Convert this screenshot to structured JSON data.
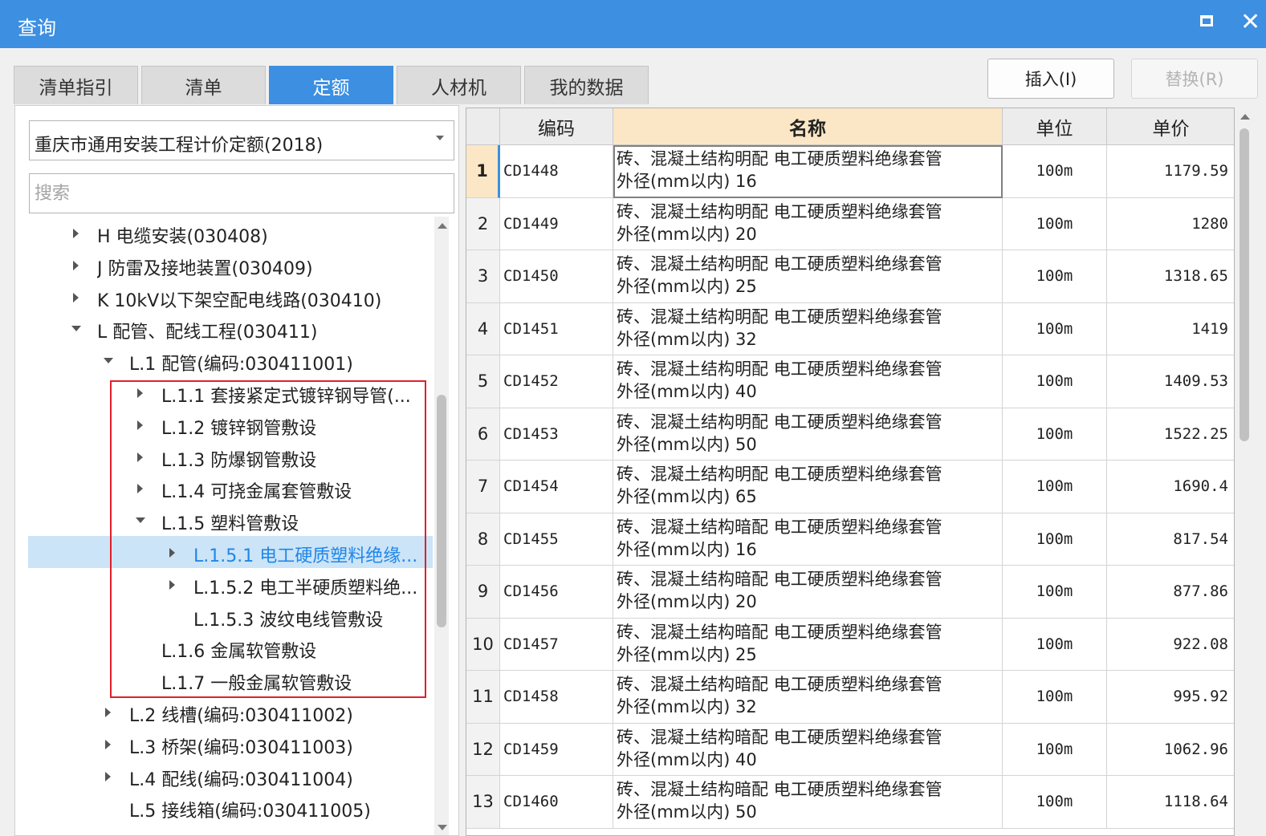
{
  "window": {
    "title": "查询"
  },
  "tabs": [
    {
      "label": "清单指引"
    },
    {
      "label": "清单"
    },
    {
      "label": "定额"
    },
    {
      "label": "人材机"
    },
    {
      "label": "我的数据"
    }
  ],
  "buttons": {
    "insert": "插入(I)",
    "replace": "替换(R)"
  },
  "left": {
    "library": "重庆市通用安装工程计价定额(2018)",
    "search_placeholder": "搜索"
  },
  "tree": [
    {
      "label": "H 电缆安装(030408)",
      "expand": "collapsed"
    },
    {
      "label": "J 防雷及接地装置(030409)",
      "expand": "collapsed"
    },
    {
      "label": "K 10kV以下架空配电线路(030410)",
      "expand": "collapsed"
    },
    {
      "label": "L 配管、配线工程(030411)",
      "expand": "expanded"
    },
    {
      "label": "L.1 配管(编码:030411001)",
      "expand": "expanded"
    },
    {
      "label": "L.1.1 套接紧定式镀锌钢导管(...",
      "expand": "collapsed"
    },
    {
      "label": "L.1.2 镀锌钢管敷设",
      "expand": "collapsed"
    },
    {
      "label": "L.1.3 防爆钢管敷设",
      "expand": "collapsed"
    },
    {
      "label": "L.1.4 可挠金属套管敷设",
      "expand": "collapsed"
    },
    {
      "label": "L.1.5 塑料管敷设",
      "expand": "expanded"
    },
    {
      "label": "L.1.5.1 电工硬质塑料绝缘...",
      "expand": "collapsed",
      "selected": true
    },
    {
      "label": "L.1.5.2 电工半硬质塑料绝...",
      "expand": "collapsed"
    },
    {
      "label": "L.1.5.3 波纹电线管敷设",
      "expand": "none"
    },
    {
      "label": "L.1.6 金属软管敷设",
      "expand": "none"
    },
    {
      "label": "L.1.7 一般金属软管敷设",
      "expand": "none"
    },
    {
      "label": "L.2 线槽(编码:030411002)",
      "expand": "collapsed"
    },
    {
      "label": "L.3 桥架(编码:030411003)",
      "expand": "collapsed"
    },
    {
      "label": "L.4 配线(编码:030411004)",
      "expand": "collapsed"
    },
    {
      "label": "L.5 接线箱(编码:030411005)",
      "expand": "none"
    }
  ],
  "table": {
    "columns": [
      "",
      "编码",
      "名称",
      "单位",
      "单价"
    ],
    "rows": [
      {
        "no": "1",
        "code": "CD1448",
        "name": "砖、混凝土结构明配 电工硬质塑料绝缘套管\n外径(mm以内) 16",
        "unit": "100m",
        "price": "1179.59"
      },
      {
        "no": "2",
        "code": "CD1449",
        "name": "砖、混凝土结构明配 电工硬质塑料绝缘套管\n外径(mm以内) 20",
        "unit": "100m",
        "price": "1280"
      },
      {
        "no": "3",
        "code": "CD1450",
        "name": "砖、混凝土结构明配 电工硬质塑料绝缘套管\n外径(mm以内) 25",
        "unit": "100m",
        "price": "1318.65"
      },
      {
        "no": "4",
        "code": "CD1451",
        "name": "砖、混凝土结构明配 电工硬质塑料绝缘套管\n外径(mm以内) 32",
        "unit": "100m",
        "price": "1419"
      },
      {
        "no": "5",
        "code": "CD1452",
        "name": "砖、混凝土结构明配 电工硬质塑料绝缘套管\n外径(mm以内) 40",
        "unit": "100m",
        "price": "1409.53"
      },
      {
        "no": "6",
        "code": "CD1453",
        "name": "砖、混凝土结构明配 电工硬质塑料绝缘套管\n外径(mm以内) 50",
        "unit": "100m",
        "price": "1522.25"
      },
      {
        "no": "7",
        "code": "CD1454",
        "name": "砖、混凝土结构明配 电工硬质塑料绝缘套管\n外径(mm以内) 65",
        "unit": "100m",
        "price": "1690.4"
      },
      {
        "no": "8",
        "code": "CD1455",
        "name": "砖、混凝土结构暗配 电工硬质塑料绝缘套管\n外径(mm以内) 16",
        "unit": "100m",
        "price": "817.54"
      },
      {
        "no": "9",
        "code": "CD1456",
        "name": "砖、混凝土结构暗配 电工硬质塑料绝缘套管\n外径(mm以内) 20",
        "unit": "100m",
        "price": "877.86"
      },
      {
        "no": "10",
        "code": "CD1457",
        "name": "砖、混凝土结构暗配 电工硬质塑料绝缘套管\n外径(mm以内) 25",
        "unit": "100m",
        "price": "922.08"
      },
      {
        "no": "11",
        "code": "CD1458",
        "name": "砖、混凝土结构暗配 电工硬质塑料绝缘套管\n外径(mm以内) 32",
        "unit": "100m",
        "price": "995.92"
      },
      {
        "no": "12",
        "code": "CD1459",
        "name": "砖、混凝土结构暗配 电工硬质塑料绝缘套管\n外径(mm以内) 40",
        "unit": "100m",
        "price": "1062.96"
      },
      {
        "no": "13",
        "code": "CD1460",
        "name": "砖、混凝土结构暗配 电工硬质塑料绝缘套管\n外径(mm以内) 50",
        "unit": "100m",
        "price": "1118.64"
      }
    ]
  },
  "colors": {
    "accent": "#3c8fe1",
    "selection_bg": "#cce4f7",
    "sorted_header_bg": "#fbe7c6",
    "highlight_box": "#e0202a"
  }
}
